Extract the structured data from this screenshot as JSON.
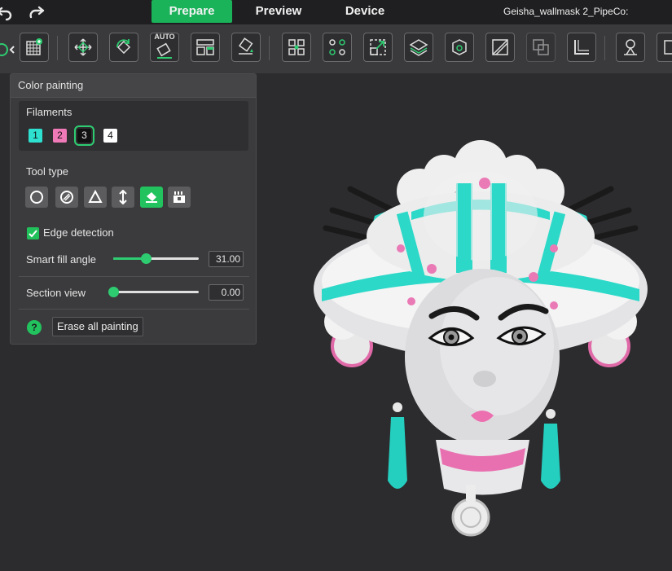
{
  "topbar": {
    "tabs": [
      {
        "label": "Prepare",
        "active": true
      },
      {
        "label": "Preview",
        "active": false
      },
      {
        "label": "Device",
        "active": false
      }
    ],
    "project_title": "Geisha_wallmask 2_PipeCo:",
    "icons": [
      "undo-icon",
      "redo-icon"
    ]
  },
  "toolbar": {
    "auto_label": "AUTO",
    "icons": [
      "add-plate-icon",
      "move-icon",
      "rotate-icon",
      "auto-orient-icon",
      "arrange-icon",
      "lay-on-face-icon",
      "split-objects-icon",
      "split-parts-icon",
      "scale-icon",
      "layers-icon",
      "cube-icon",
      "cut-icon",
      "boolean-icon",
      "measure-icon",
      "support-paint-icon",
      "seam-paint-icon"
    ]
  },
  "panel": {
    "title": "Color painting",
    "filaments_label": "Filaments",
    "filaments": [
      {
        "label": "1",
        "color": "#2de0d0"
      },
      {
        "label": "2",
        "color": "#f07ab8"
      },
      {
        "label": "3",
        "color": "#111111",
        "selected": true
      },
      {
        "label": "4",
        "color": "#ffffff"
      }
    ],
    "tool_type_label": "Tool type",
    "tools": [
      "circle-brush-icon",
      "sphere-brush-icon",
      "triangle-brush-icon",
      "height-range-icon",
      "fill-bucket-icon",
      "gap-fill-icon"
    ],
    "active_tool": "fill-bucket-icon",
    "edge_detection_label": "Edge detection",
    "edge_detection_checked": true,
    "smart_fill": {
      "label": "Smart fill angle",
      "value": "31.00",
      "fraction": 0.38
    },
    "section_view": {
      "label": "Section view",
      "value": "0.00",
      "fraction": 0.0
    },
    "help_icon": "?",
    "erase_label": "Erase all painting"
  },
  "colors": {
    "accent": "#1bb35a",
    "teal": "#2de0d0",
    "pink": "#f07ab8"
  }
}
